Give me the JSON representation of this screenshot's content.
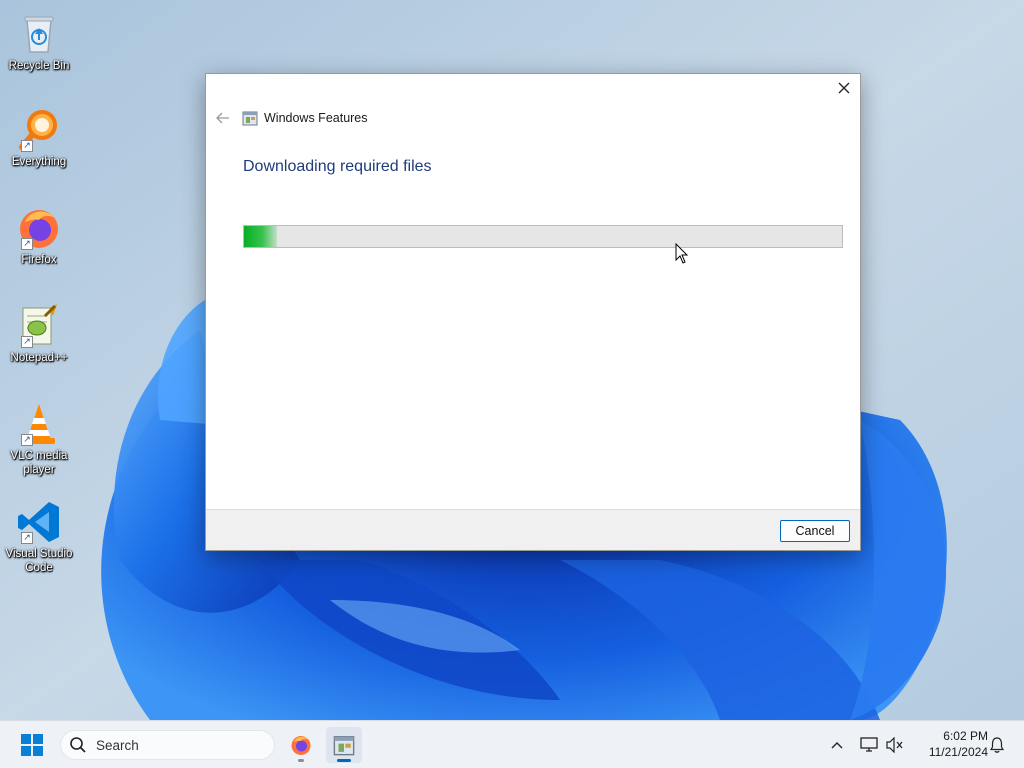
{
  "desktop": {
    "icons": [
      {
        "label": "Recycle Bin",
        "icon": "recycle-bin-icon"
      },
      {
        "label": "Everything",
        "icon": "everything-search-icon"
      },
      {
        "label": "Firefox",
        "icon": "firefox-icon"
      },
      {
        "label": "Notepad++",
        "icon": "notepad-plus-plus-icon"
      },
      {
        "label": "VLC media player",
        "icon": "vlc-cone-icon"
      },
      {
        "label": "Visual Studio Code",
        "icon": "vscode-icon"
      }
    ]
  },
  "dialog": {
    "app_title": "Windows Features",
    "heading": "Downloading required files",
    "progress": 0.055,
    "cancel_label": "Cancel",
    "colors": {
      "heading": "#1e3d7a",
      "progress_fill": "#06b025",
      "button_border": "#0067c0"
    }
  },
  "taskbar": {
    "search_label": "Search",
    "apps": [
      {
        "name": "Firefox",
        "icon": "firefox-icon",
        "active": false
      },
      {
        "name": "Windows Features",
        "icon": "windows-features-icon",
        "active": true
      }
    ],
    "clock": {
      "time": "6:02 PM",
      "date": "11/21/2024"
    }
  }
}
